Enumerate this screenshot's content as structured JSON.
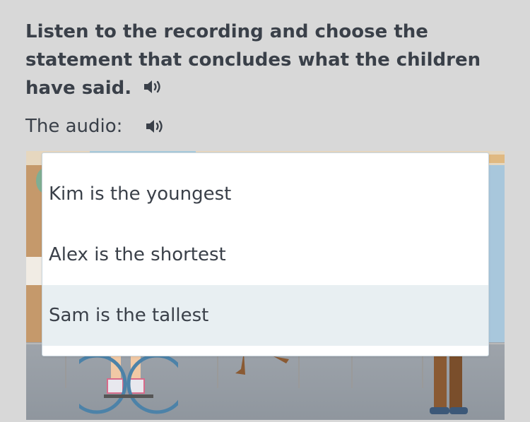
{
  "question": {
    "text": "Listen to the recording and choose the statement that concludes what the children have said.",
    "speaker_icon": "speaker-icon"
  },
  "audio": {
    "label": "The audio:",
    "speaker_icon": "speaker-icon"
  },
  "dropdown": {
    "options": [
      {
        "label": "Kim is the youngest",
        "highlighted": false
      },
      {
        "label": "Alex is the shortest",
        "highlighted": false
      },
      {
        "label": "Sam is the tallest",
        "highlighted": true
      }
    ],
    "highlight_color": "#e8eff2"
  },
  "colors": {
    "page_background": "#d8d8d8",
    "text": "#3a4049",
    "wheelchair": "#4c82a8"
  }
}
